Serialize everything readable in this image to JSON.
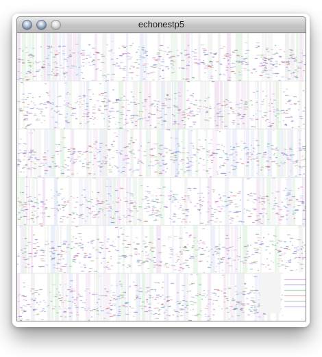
{
  "window": {
    "title": "echonestp5"
  },
  "canvas": {
    "rows": 6,
    "background": "#ffffff",
    "stripe_colors": [
      "#f0f0f0",
      "#e8ecf8",
      "#f3e6f3",
      "#e6f4e6"
    ],
    "tick_colors": [
      "#cc66cc",
      "#6666cc",
      "#66aa66",
      "#cc6666",
      "#999999",
      "#aa88cc",
      "#6699cc"
    ]
  }
}
